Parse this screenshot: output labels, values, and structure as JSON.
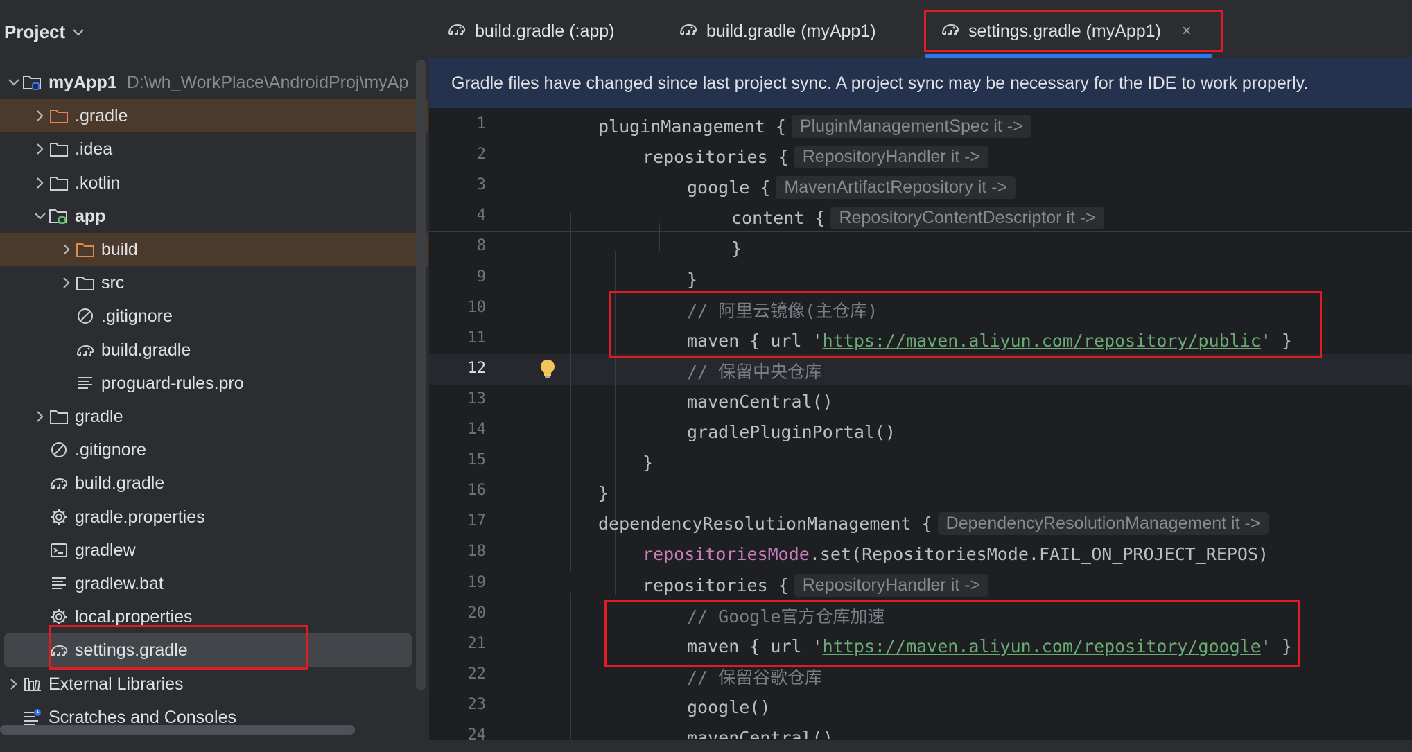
{
  "project_panel": {
    "title": "Project",
    "tree": [
      {
        "label": "myApp1",
        "path": "D:\\wh_WorkPlace\\AndroidProj\\myAp",
        "bold": true,
        "arrow": "expanded",
        "icon": "module-folder-icon"
      },
      {
        "label": ".gradle",
        "arrow": "collapsed",
        "icon": "excluded-folder-icon"
      },
      {
        "label": ".idea",
        "arrow": "collapsed",
        "icon": "folder-icon"
      },
      {
        "label": ".kotlin",
        "arrow": "collapsed",
        "icon": "folder-icon"
      },
      {
        "label": "app",
        "bold": true,
        "arrow": "expanded",
        "icon": "module-folder-icon"
      },
      {
        "label": "build",
        "arrow": "collapsed",
        "icon": "excluded-folder-icon"
      },
      {
        "label": "src",
        "arrow": "collapsed",
        "icon": "folder-icon"
      },
      {
        "label": ".gitignore",
        "icon": "ignore-file-icon"
      },
      {
        "label": "build.gradle",
        "icon": "gradle-elephant-icon"
      },
      {
        "label": "proguard-rules.pro",
        "icon": "text-file-icon"
      },
      {
        "label": "gradle",
        "arrow": "collapsed",
        "icon": "folder-icon"
      },
      {
        "label": ".gitignore",
        "icon": "ignore-file-icon"
      },
      {
        "label": "build.gradle",
        "icon": "gradle-elephant-icon"
      },
      {
        "label": "gradle.properties",
        "icon": "settings-gear-icon"
      },
      {
        "label": "gradlew",
        "icon": "terminal-script-icon"
      },
      {
        "label": "gradlew.bat",
        "icon": "text-file-icon"
      },
      {
        "label": "local.properties",
        "icon": "settings-gear-icon"
      },
      {
        "label": "settings.gradle",
        "icon": "gradle-elephant-icon",
        "selected": true
      },
      {
        "label": "External Libraries",
        "arrow": "collapsed",
        "icon": "libraries-icon"
      },
      {
        "label": "Scratches and Consoles",
        "icon": "scratches-icon"
      }
    ]
  },
  "editor": {
    "tabs": [
      {
        "label": "build.gradle (:app)",
        "icon": "gradle-elephant-icon"
      },
      {
        "label": "build.gradle (myApp1)",
        "icon": "gradle-elephant-icon"
      },
      {
        "label": "settings.gradle (myApp1)",
        "icon": "gradle-elephant-icon",
        "active": true,
        "close": "×"
      }
    ],
    "banner": "Gradle files have changed since last project sync. A project sync may be necessary for the IDE to work properly.",
    "current_line": "12",
    "lines": [
      {
        "n": "1",
        "code": "pluginManagement {",
        "hint": "PluginManagementSpec it ->"
      },
      {
        "n": "2",
        "code": "repositories {",
        "hint": "RepositoryHandler it ->"
      },
      {
        "n": "3",
        "code": "google {",
        "hint": "MavenArtifactRepository it ->"
      },
      {
        "n": "4",
        "code": "content {",
        "hint": "RepositoryContentDescriptor it ->"
      },
      {
        "n": "8",
        "code": "}"
      },
      {
        "n": "9",
        "code": "}"
      },
      {
        "n": "10",
        "comment": "// 阿里云镜像(主仓库)"
      },
      {
        "n": "11",
        "pre": "maven { url '",
        "url": "https://maven.aliyun.com/repository/public",
        "post": "' }"
      },
      {
        "n": "12",
        "comment": "// 保留中央仓库"
      },
      {
        "n": "13",
        "code": "mavenCentral()"
      },
      {
        "n": "14",
        "code": "gradlePluginPortal()"
      },
      {
        "n": "15",
        "code": "}"
      },
      {
        "n": "16",
        "code": "}"
      },
      {
        "n": "17",
        "code": "dependencyResolutionManagement {",
        "hint": "DependencyResolutionManagement it ->"
      },
      {
        "n": "18",
        "prop": "repositoriesMode",
        "rest": ".set(RepositoriesMode.FAIL_ON_PROJECT_REPOS)"
      },
      {
        "n": "19",
        "code": "repositories {",
        "hint": "RepositoryHandler it ->"
      },
      {
        "n": "20",
        "comment": "// Google官方仓库加速"
      },
      {
        "n": "21",
        "pre": "maven { url '",
        "url": "https://maven.aliyun.com/repository/google",
        "post": "' }"
      },
      {
        "n": "22",
        "comment": "// 保留谷歌仓库"
      },
      {
        "n": "23",
        "code": "google()"
      },
      {
        "n": "24",
        "code": "mavenCentral()"
      }
    ]
  },
  "colors": {
    "annotation_red": "#e01b24",
    "active_tab_underline": "#3574f0",
    "banner_bg": "#25324d",
    "string_green": "#6aab73",
    "property_purple": "#c77dbb"
  }
}
